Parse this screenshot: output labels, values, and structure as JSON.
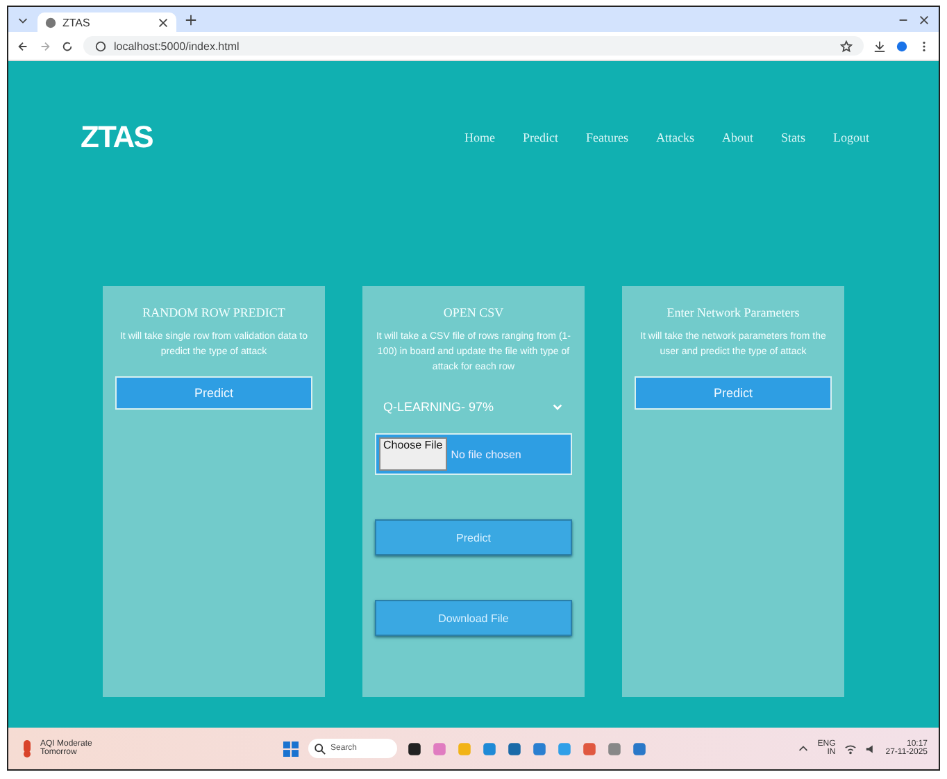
{
  "browser": {
    "tab_title": "ZTAS",
    "address": "localhost:5000/index.html"
  },
  "nav": {
    "brand": "ZTAS",
    "links": [
      "Home",
      "Predict",
      "Features",
      "Attacks",
      "About",
      "Stats",
      "Logout"
    ]
  },
  "cards": [
    {
      "kind": "action",
      "title": "RANDOM ROW PREDICT",
      "description": "It will take single row from validation data to predict the type of attack",
      "button": "Predict"
    },
    {
      "kind": "upload",
      "title": "OPEN CSV",
      "description": "It will take a CSV file of rows ranging from (1-100) in board and update the file with type of attack for each row",
      "select_value": "Q-LEARNING- 97%",
      "file_button": "Choose File",
      "file_status": "No file chosen",
      "buttons": [
        "Predict",
        "Download File"
      ]
    },
    {
      "kind": "action",
      "title": "Enter Network Parameters",
      "description": "It will take the network parameters from the user and predict the type of attack",
      "button": "Predict"
    }
  ],
  "taskbar": {
    "weather": [
      "AQI Moderate",
      "Tomorrow"
    ],
    "search_placeholder": "Search",
    "language": [
      "ENG",
      "IN"
    ],
    "time": "10:17",
    "date": "27-11-2025"
  }
}
